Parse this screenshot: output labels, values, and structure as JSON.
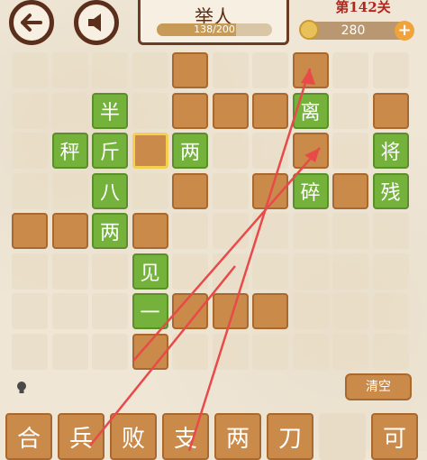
{
  "header": {
    "back_icon": "back-arrow-icon",
    "sound_icon": "speaker-icon",
    "answer_title": "举人",
    "progress_text": "138/200",
    "progress_fraction": 0.69,
    "level_text": "第142关",
    "coin_icon": "coin-icon",
    "coins": "280",
    "add_icon": "plus-icon"
  },
  "board": {
    "tiles": [
      {
        "id": "r0c4",
        "state": "blank",
        "char": ""
      },
      {
        "id": "r0c7",
        "state": "blank",
        "char": ""
      },
      {
        "id": "r1c2",
        "state": "filled",
        "char": "半"
      },
      {
        "id": "r1c4",
        "state": "blank",
        "char": ""
      },
      {
        "id": "r1c5",
        "state": "blank",
        "char": ""
      },
      {
        "id": "r1c6",
        "state": "blank",
        "char": ""
      },
      {
        "id": "r1c7",
        "state": "filled",
        "char": "离"
      },
      {
        "id": "r1c9",
        "state": "blank",
        "char": ""
      },
      {
        "id": "r2c1",
        "state": "filled",
        "char": "秤"
      },
      {
        "id": "r2c2",
        "state": "filled",
        "char": "斤"
      },
      {
        "id": "r2c3",
        "state": "selected",
        "char": ""
      },
      {
        "id": "r2c4",
        "state": "filled",
        "char": "两"
      },
      {
        "id": "r2c7",
        "state": "blank",
        "char": ""
      },
      {
        "id": "r2c9",
        "state": "filled",
        "char": "将"
      },
      {
        "id": "r3c2",
        "state": "filled",
        "char": "八"
      },
      {
        "id": "r3c4",
        "state": "blank",
        "char": ""
      },
      {
        "id": "r3c6",
        "state": "blank",
        "char": ""
      },
      {
        "id": "r3c7",
        "state": "filled",
        "char": "碎"
      },
      {
        "id": "r3c8",
        "state": "blank",
        "char": ""
      },
      {
        "id": "r3c9",
        "state": "filled",
        "char": "残"
      },
      {
        "id": "r4c0",
        "state": "blank",
        "char": ""
      },
      {
        "id": "r4c1",
        "state": "blank",
        "char": ""
      },
      {
        "id": "r4c2",
        "state": "filled",
        "char": "两"
      },
      {
        "id": "r4c3",
        "state": "blank",
        "char": ""
      },
      {
        "id": "r5c3",
        "state": "filled",
        "char": "见"
      },
      {
        "id": "r6c3",
        "state": "filled",
        "char": "一"
      },
      {
        "id": "r6c4",
        "state": "blank",
        "char": ""
      },
      {
        "id": "r6c5",
        "state": "blank",
        "char": ""
      },
      {
        "id": "r6c6",
        "state": "blank",
        "char": ""
      },
      {
        "id": "r7c3",
        "state": "blank",
        "char": ""
      }
    ]
  },
  "controls": {
    "hint_icon": "lightbulb-icon",
    "clear_label": "清空"
  },
  "choices": [
    {
      "char": "合",
      "used": false
    },
    {
      "char": "兵",
      "used": false
    },
    {
      "char": "败",
      "used": false
    },
    {
      "char": "支",
      "used": false
    },
    {
      "char": "两",
      "used": false
    },
    {
      "char": "刀",
      "used": false
    },
    {
      "char": "",
      "used": true
    },
    {
      "char": "可",
      "used": false
    }
  ],
  "annotations": {
    "arrow_color": "#e84a4a"
  }
}
